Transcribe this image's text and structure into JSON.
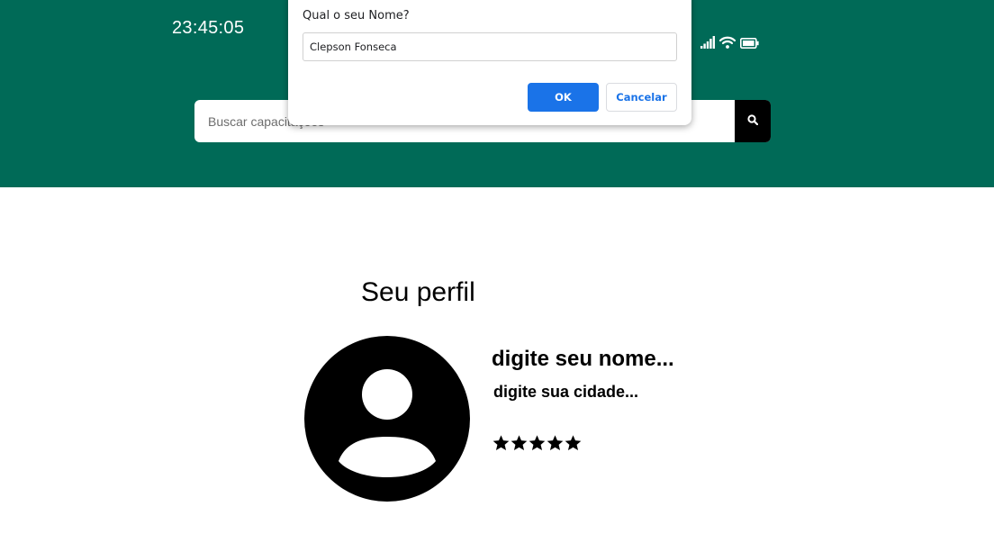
{
  "header": {
    "time": "23:45:05",
    "status_icons": [
      "signal-icon",
      "wifi-icon",
      "battery-icon"
    ],
    "background_color": "#006a57"
  },
  "search": {
    "placeholder": "Buscar capacitações",
    "button_icon": "search-icon"
  },
  "dialog": {
    "title": "Qual o seu Nome?",
    "input_value": "Clepson Fonseca",
    "ok_label": "OK",
    "cancel_label": "Cancelar",
    "accent_color": "#1a73e8"
  },
  "profile": {
    "title": "Seu perfil",
    "name": "digite seu nome...",
    "city": "digite sua cidade...",
    "avatar_icon": "user-avatar-icon",
    "rating": 5,
    "rating_max": 5
  }
}
